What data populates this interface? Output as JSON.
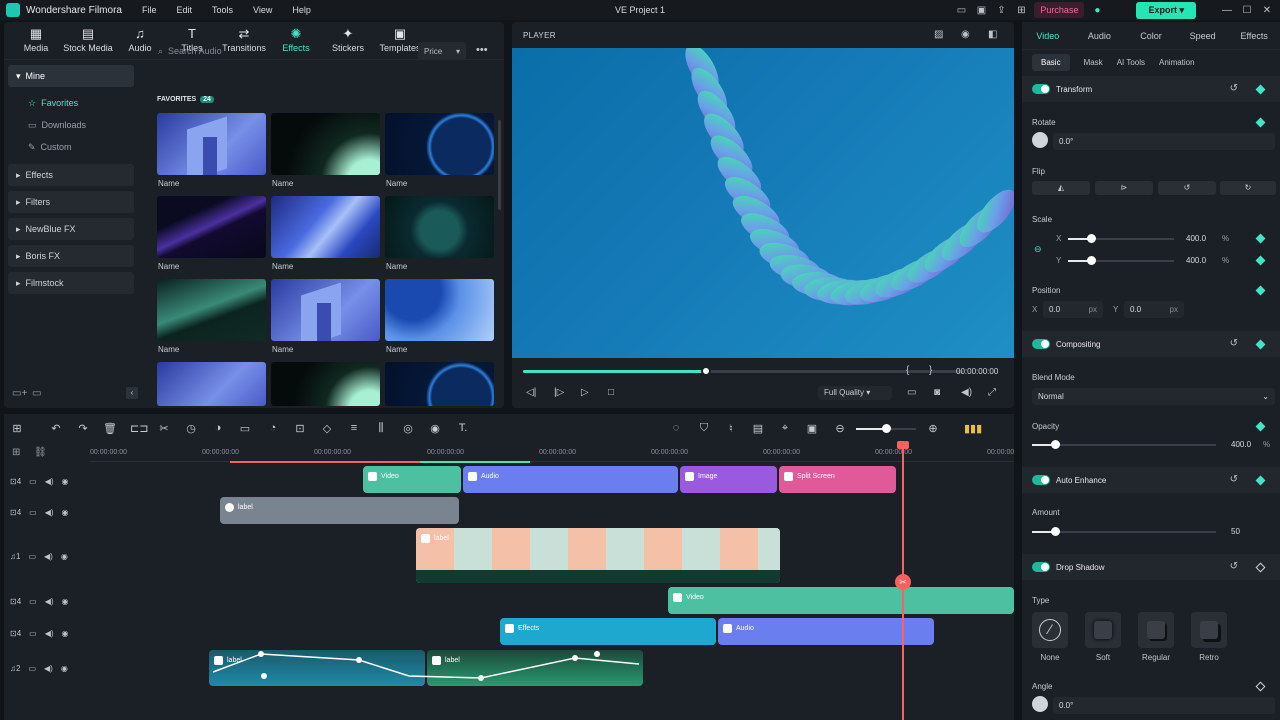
{
  "app": {
    "name": "Wondershare Filmora",
    "project_title": "VE Project 1",
    "purchase_label": "Purchase",
    "export_label": "Export",
    "accent": "#3ee6c8"
  },
  "menu": [
    "File",
    "Edit",
    "Tools",
    "View",
    "Help"
  ],
  "library_tabs": [
    {
      "label": "Media",
      "icon": "media-icon"
    },
    {
      "label": "Stock Media",
      "icon": "stock-media-icon"
    },
    {
      "label": "Audio",
      "icon": "audio-icon"
    },
    {
      "label": "Titles",
      "icon": "titles-icon"
    },
    {
      "label": "Transitions",
      "icon": "transitions-icon"
    },
    {
      "label": "Effects",
      "icon": "effects-icon"
    },
    {
      "label": "Stickers",
      "icon": "stickers-icon"
    },
    {
      "label": "Templates",
      "icon": "templates-icon"
    }
  ],
  "sidebar": {
    "mine": "Mine",
    "mine_items": [
      "Favorites",
      "Downloads",
      "Custom"
    ],
    "groups": [
      "Effects",
      "Filters",
      "NewBlue FX",
      "Boris FX",
      "Filmstock"
    ]
  },
  "search": {
    "placeholder": "Search Audio",
    "sort": "Price"
  },
  "favorites": {
    "label": "FAVORITES",
    "count": "24",
    "items": [
      "Name",
      "Name",
      "Name",
      "Name",
      "Name",
      "Name",
      "Name",
      "Name",
      "Name"
    ]
  },
  "player": {
    "label": "PLAYER",
    "timecode": "00:00:00:00",
    "quality": "Full Quality",
    "progress": 0.42
  },
  "ruler": [
    "00:00:00:00",
    "00:00:00:00",
    "00:00:00:00",
    "00:00:00:00",
    "00:00:00:00",
    "00:00:00:00",
    "00:00:00:00",
    "00:00:00:00",
    "00:00:00:00"
  ],
  "tracks": [
    {
      "num": "4"
    },
    {
      "num": "4"
    },
    {
      "num": "1"
    },
    {
      "num": "4"
    },
    {
      "num": "4"
    },
    {
      "num": "2"
    }
  ],
  "clips": {
    "video1": "Video",
    "audio1": "Audio",
    "image1": "Image",
    "split1": "Split Screen",
    "label1": "label",
    "label2": "label",
    "video2": "Video",
    "effects1": "Effects",
    "audio2": "Audio",
    "label3": "label",
    "label4": "label"
  },
  "props": {
    "tabs": [
      "Video",
      "Audio",
      "Color",
      "Speed",
      "Effects"
    ],
    "subtabs": [
      "Basic",
      "Mask",
      "AI Tools",
      "Animation"
    ],
    "transform": "Transform",
    "rotate": "Rotate",
    "rotate_val": "0.0°",
    "flip": "Flip",
    "scale": "Scale",
    "x": "X",
    "y": "Y",
    "scale_x": "400.0",
    "scale_y": "400.0",
    "pct": "%",
    "position": "Position",
    "pos_x": "0.0",
    "pos_y": "0.0",
    "px": "px",
    "compositing": "Compositing",
    "blend_mode": "Blend Mode",
    "blend_val": "Normal",
    "opacity": "Opacity",
    "opacity_val": "400.0",
    "auto_enhance": "Auto Enhance",
    "amount": "Amount",
    "amount_val": "50",
    "drop_shadow": "Drop Shadow",
    "type": "Type",
    "shadow_types": [
      "None",
      "Soft",
      "Regular",
      "Retro"
    ],
    "angle": "Angle",
    "angle_val": "0.0°"
  }
}
